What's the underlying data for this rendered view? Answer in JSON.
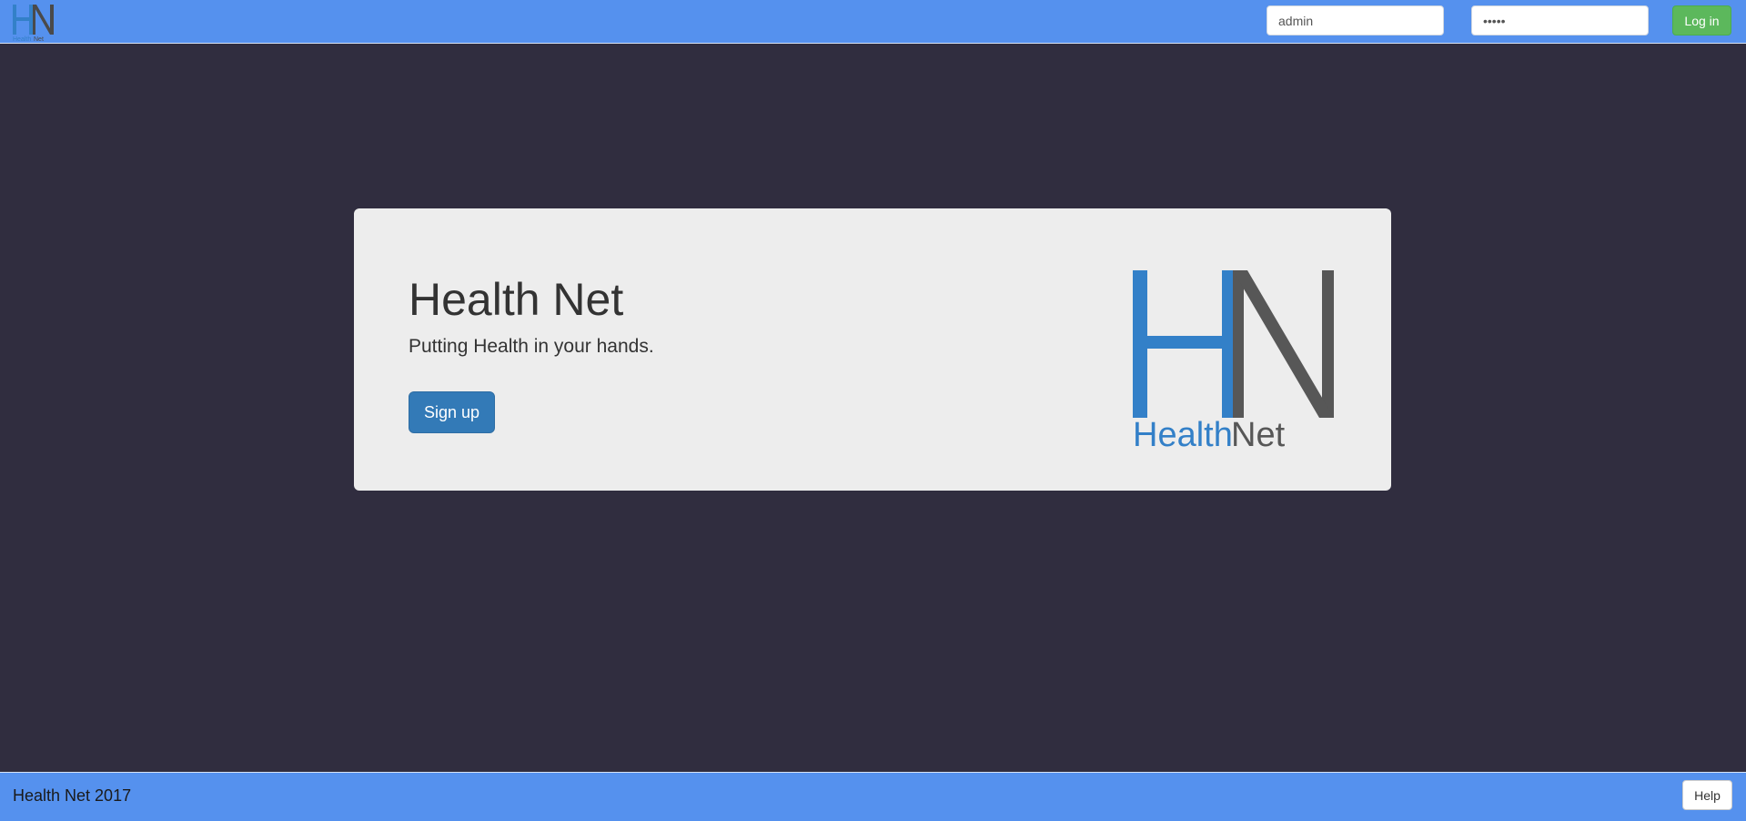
{
  "navbar": {
    "logo": {
      "letter_h": "H",
      "letter_n": "N",
      "word_health": "Health",
      "word_net": "Net"
    },
    "username": {
      "value": "admin"
    },
    "password": {
      "value": "•••••"
    },
    "login_label": "Log in"
  },
  "hero": {
    "title": "Health Net",
    "subtitle": "Putting Health in your hands.",
    "signup_label": "Sign up",
    "logo": {
      "letter_h": "H",
      "letter_n": "N",
      "word_health": "Health",
      "word_net": "Net"
    }
  },
  "footer": {
    "text": "Health Net 2017",
    "help_label": "Help"
  },
  "colors": {
    "navbar_bg": "#5591ee",
    "page_bg": "#302d3f",
    "hero_bg": "#ededed",
    "brand_blue": "#3380c8",
    "brand_gray": "#575757",
    "login_green": "#5cb85c",
    "signup_blue": "#337ab7"
  },
  "icons": {
    "nav_logo": "healthnet-logo",
    "hero_logo": "healthnet-logo"
  }
}
